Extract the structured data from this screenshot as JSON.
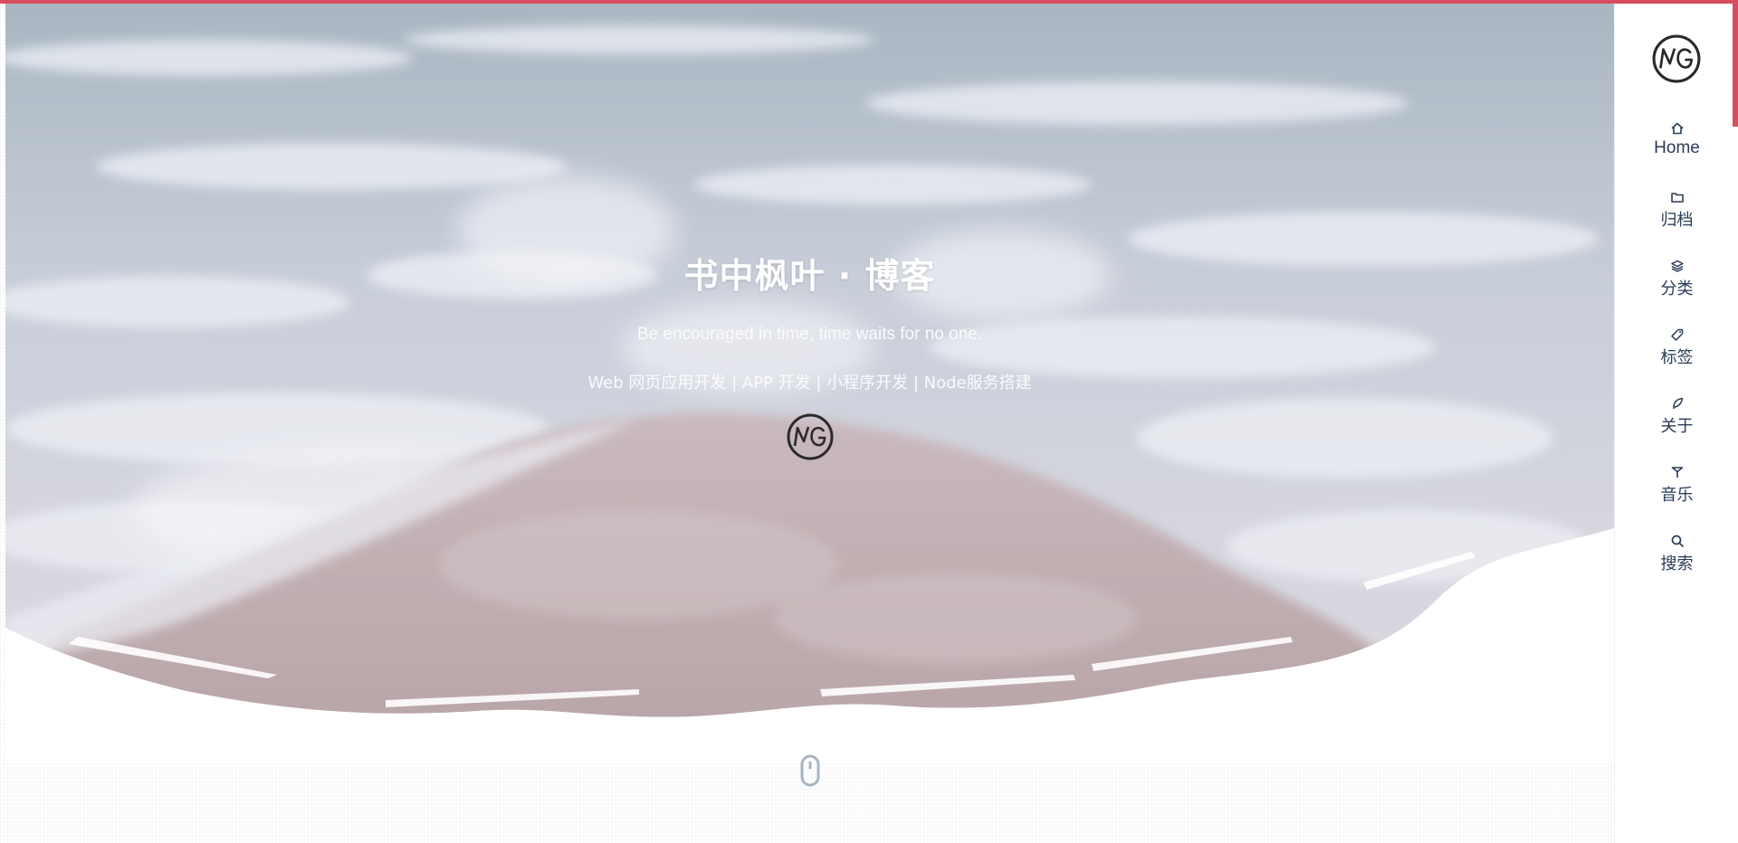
{
  "page": {
    "title": "书中枫叶 · 博客",
    "motto": "Be encouraged in time, time waits for no one.",
    "subtitle": "Web 网页应用开发 | APP 开发 | 小程序开发 | Node服务搭建"
  },
  "brand": {
    "logo_icon": "mg-logo-icon",
    "logo_text": "MG"
  },
  "nav": {
    "items": [
      {
        "label": "Home",
        "icon": "home-icon"
      },
      {
        "label": "归档",
        "icon": "folder-icon"
      },
      {
        "label": "分类",
        "icon": "layers-icon"
      },
      {
        "label": "标签",
        "icon": "tag-icon"
      },
      {
        "label": "关于",
        "icon": "feather-icon"
      },
      {
        "label": "音乐",
        "icon": "music-icon"
      },
      {
        "label": "搜索",
        "icon": "search-icon"
      }
    ]
  },
  "scroll_hint": {
    "icon": "mouse-icon"
  },
  "colors": {
    "accent": "#d94b5e",
    "nav_text": "#2b3b57",
    "hero_text": "#ffffff",
    "mouse": "#a9b4c4"
  }
}
